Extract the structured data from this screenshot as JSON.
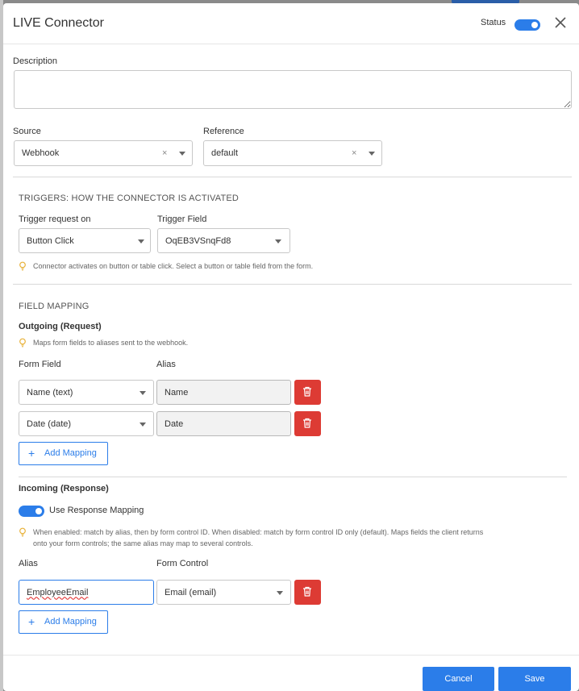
{
  "header": {
    "title": "LIVE Connector",
    "status_label": "Status",
    "status_on": true
  },
  "description": {
    "label": "Description",
    "value": ""
  },
  "source": {
    "label": "Source",
    "value": "Webhook"
  },
  "reference": {
    "label": "Reference",
    "value": "default"
  },
  "triggers": {
    "heading": "TRIGGERS: HOW THE CONNECTOR IS ACTIVATED",
    "request_label": "Trigger request on",
    "request_value": "Button Click",
    "field_label": "Trigger Field",
    "field_value": "OqEB3VSnqFd8",
    "hint": "Connector activates on button or table click. Select a button or table field from the form."
  },
  "mapping": {
    "heading": "FIELD MAPPING",
    "outgoing": {
      "title": "Outgoing (Request)",
      "hint": "Maps form fields to aliases sent to the webhook.",
      "col_field": "Form Field",
      "col_alias": "Alias",
      "rows": [
        {
          "field": "Name (text)",
          "alias": "Name"
        },
        {
          "field": "Date (date)",
          "alias": "Date"
        }
      ],
      "add_label": "Add Mapping"
    },
    "incoming": {
      "title": "Incoming (Response)",
      "toggle_label": "Use Response Mapping",
      "toggle_on": true,
      "hint_line1": "When enabled: match by alias, then by form control ID. When disabled: match by form control ID only (default). Maps fields the client returns",
      "hint_line2": "onto your form controls; the same alias may map to several controls.",
      "col_alias": "Alias",
      "col_control": "Form Control",
      "rows": [
        {
          "alias": "EmployeeEmail",
          "control": "Email (email)"
        }
      ],
      "add_label": "Add Mapping"
    }
  },
  "footer": {
    "cancel_label": "Cancel",
    "save_label": "Save"
  },
  "colors": {
    "primary": "#2b7de9",
    "danger": "#dd3b34"
  }
}
